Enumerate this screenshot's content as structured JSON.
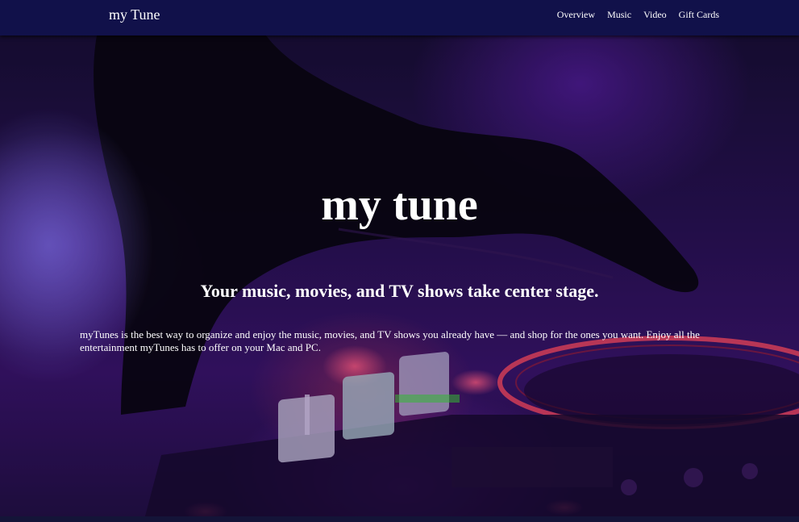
{
  "navbar": {
    "brand": "my Tune",
    "links": [
      "Overview",
      "Music",
      "Video",
      "Gift Cards"
    ]
  },
  "hero": {
    "title": "my tune",
    "subtitle": "Your music, movies, and TV shows take center stage.",
    "body": "myTunes is the best way to organize and enjoy the music, movies, and TV shows you already have — and shop for the ones you want. Enjoy all the entertainment myTunes has to offer on your Mac and PC."
  },
  "colors": {
    "navbar_bg": "#11114a",
    "hero_tint": "#3b1470",
    "accent_red": "#ff4a6a",
    "text": "#ffffff"
  }
}
